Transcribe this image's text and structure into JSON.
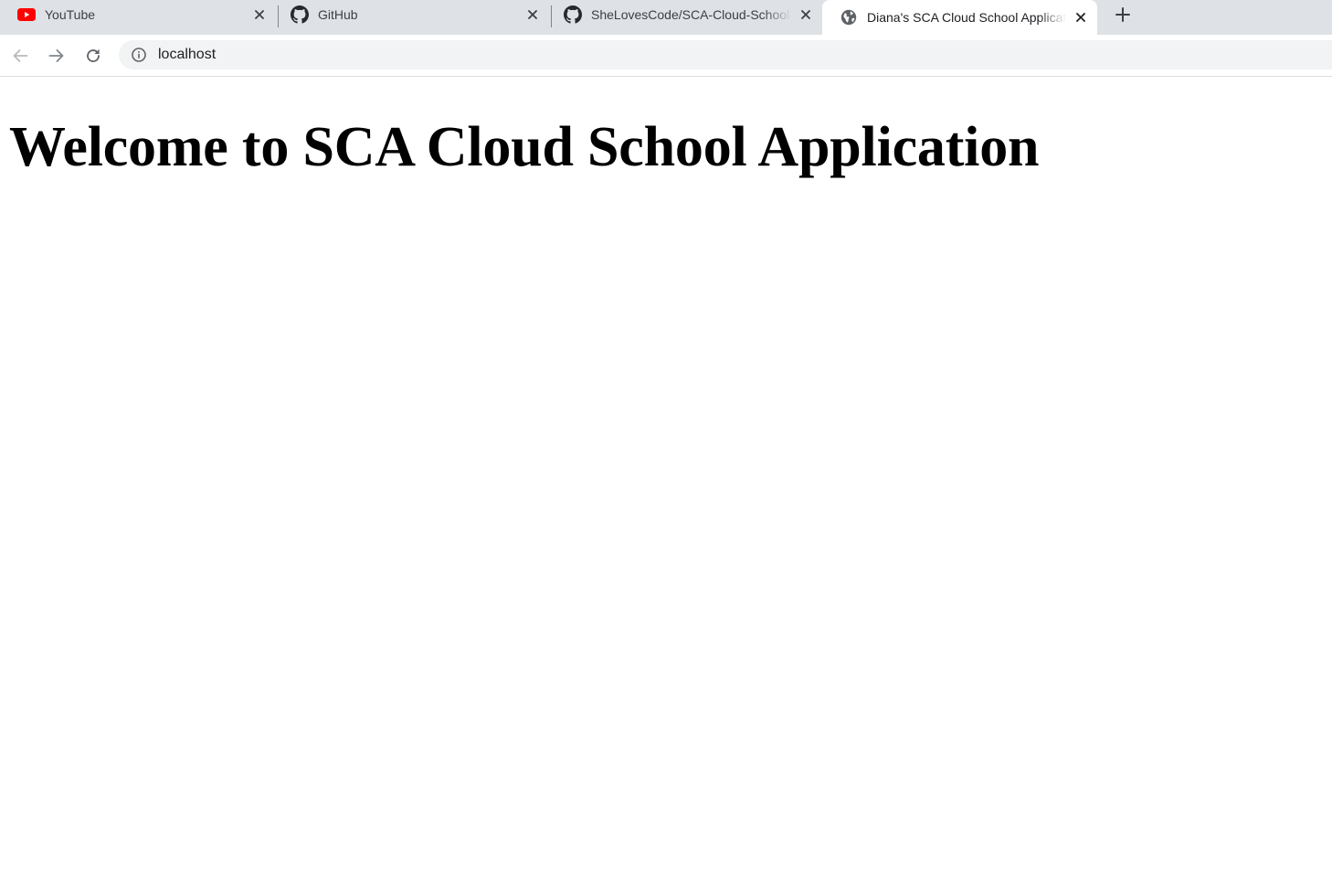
{
  "browser": {
    "tabs": [
      {
        "title": "YouTube",
        "icon": "youtube-icon",
        "active": false
      },
      {
        "title": "GitHub",
        "icon": "github-icon",
        "active": false
      },
      {
        "title": "SheLovesCode/SCA-Cloud-School-Application",
        "icon": "github-icon",
        "active": false
      },
      {
        "title": "Diana's SCA Cloud School Application",
        "icon": "globe-icon",
        "active": true
      }
    ],
    "address_bar": {
      "url": "localhost",
      "security_icon": "info-icon"
    },
    "colors": {
      "tabstrip_bg": "#dee1e6",
      "omnibox_bg": "#f1f3f4",
      "youtube_red": "#ff0000"
    }
  },
  "page": {
    "heading": "Welcome to SCA Cloud School Application"
  }
}
